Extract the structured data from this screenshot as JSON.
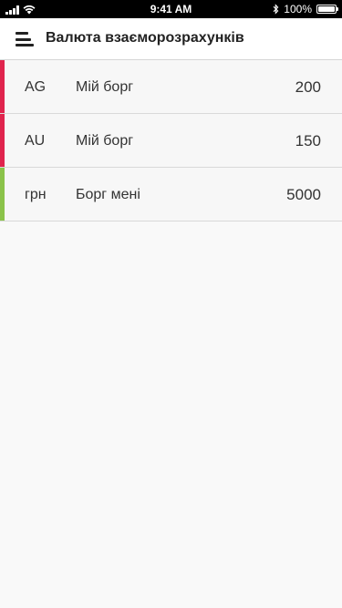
{
  "status_bar": {
    "time": "9:41 AM",
    "battery": "100%",
    "icons": [
      "signal-icon",
      "wifi-icon",
      "bluetooth-icon",
      "battery-icon"
    ]
  },
  "header": {
    "title": "Валюта взаєморозрахунків",
    "menu_icon": "hamburger-menu-icon"
  },
  "rows": [
    {
      "currency": "AG",
      "type": "Мій борг",
      "amount": "200",
      "accent": "#e0244d"
    },
    {
      "currency": "AU",
      "type": "Мій борг",
      "amount": "150",
      "accent": "#e0244d"
    },
    {
      "currency": "грн",
      "type": "Борг мені",
      "amount": "5000",
      "accent": "#8bc34a"
    }
  ],
  "colors": {
    "debt_mine": "#e0244d",
    "debt_to_me": "#8bc34a",
    "background": "#f9f9f9"
  }
}
